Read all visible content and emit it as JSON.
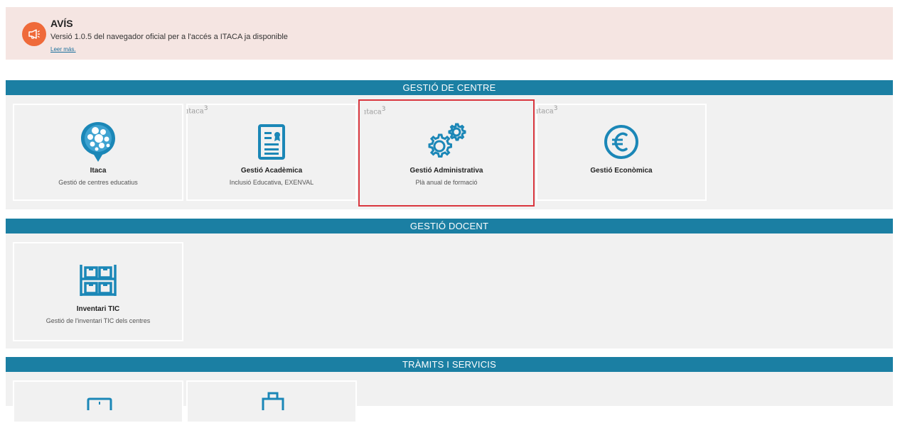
{
  "notice": {
    "title": "AVÍS",
    "text": "Versió 1.0.5 del navegador oficial per a l'accés a ITACA ja disponible",
    "link": "Leer más."
  },
  "sections": {
    "gestio_centre": {
      "header": "GESTIÓ DE CENTRE",
      "tiles": {
        "itaca": {
          "title": "Itaca",
          "subtitle": "Gestió de centres educatius"
        },
        "academica": {
          "brand": "ıtaca",
          "brand_version": "3",
          "title": "Gestió Acadèmica",
          "subtitle": "Inclusió Educativa, EXENVAL"
        },
        "administrativa": {
          "brand": "ıtaca",
          "brand_version": "3",
          "title": "Gestió Administrativa",
          "subtitle": "Plà anual de formació"
        },
        "economica": {
          "brand": "ıtaca",
          "brand_version": "3",
          "title": "Gestió Econòmica",
          "subtitle": ""
        }
      }
    },
    "gestio_docent": {
      "header": "GESTIÓ DOCENT",
      "tiles": {
        "inventari": {
          "title": "Inventari TIC",
          "subtitle": "Gestió de l'inventari TIC dels centres"
        }
      }
    },
    "tramits": {
      "header": "TRÀMITS I SERVICIS"
    }
  },
  "icons": {
    "notice": "megaphone-icon",
    "itaca": "itaca-bubbles-icon",
    "academica": "document-certificate-icon",
    "administrativa": "gears-icon",
    "economica": "euro-icon",
    "inventari": "shelves-icon"
  },
  "colors": {
    "accent": "#1b7fa3",
    "notice_bg": "#f5e5e2",
    "notice_icon": "#ef6a3a",
    "selected_border": "#d9363e",
    "icon_blue": "#1b87b7"
  }
}
